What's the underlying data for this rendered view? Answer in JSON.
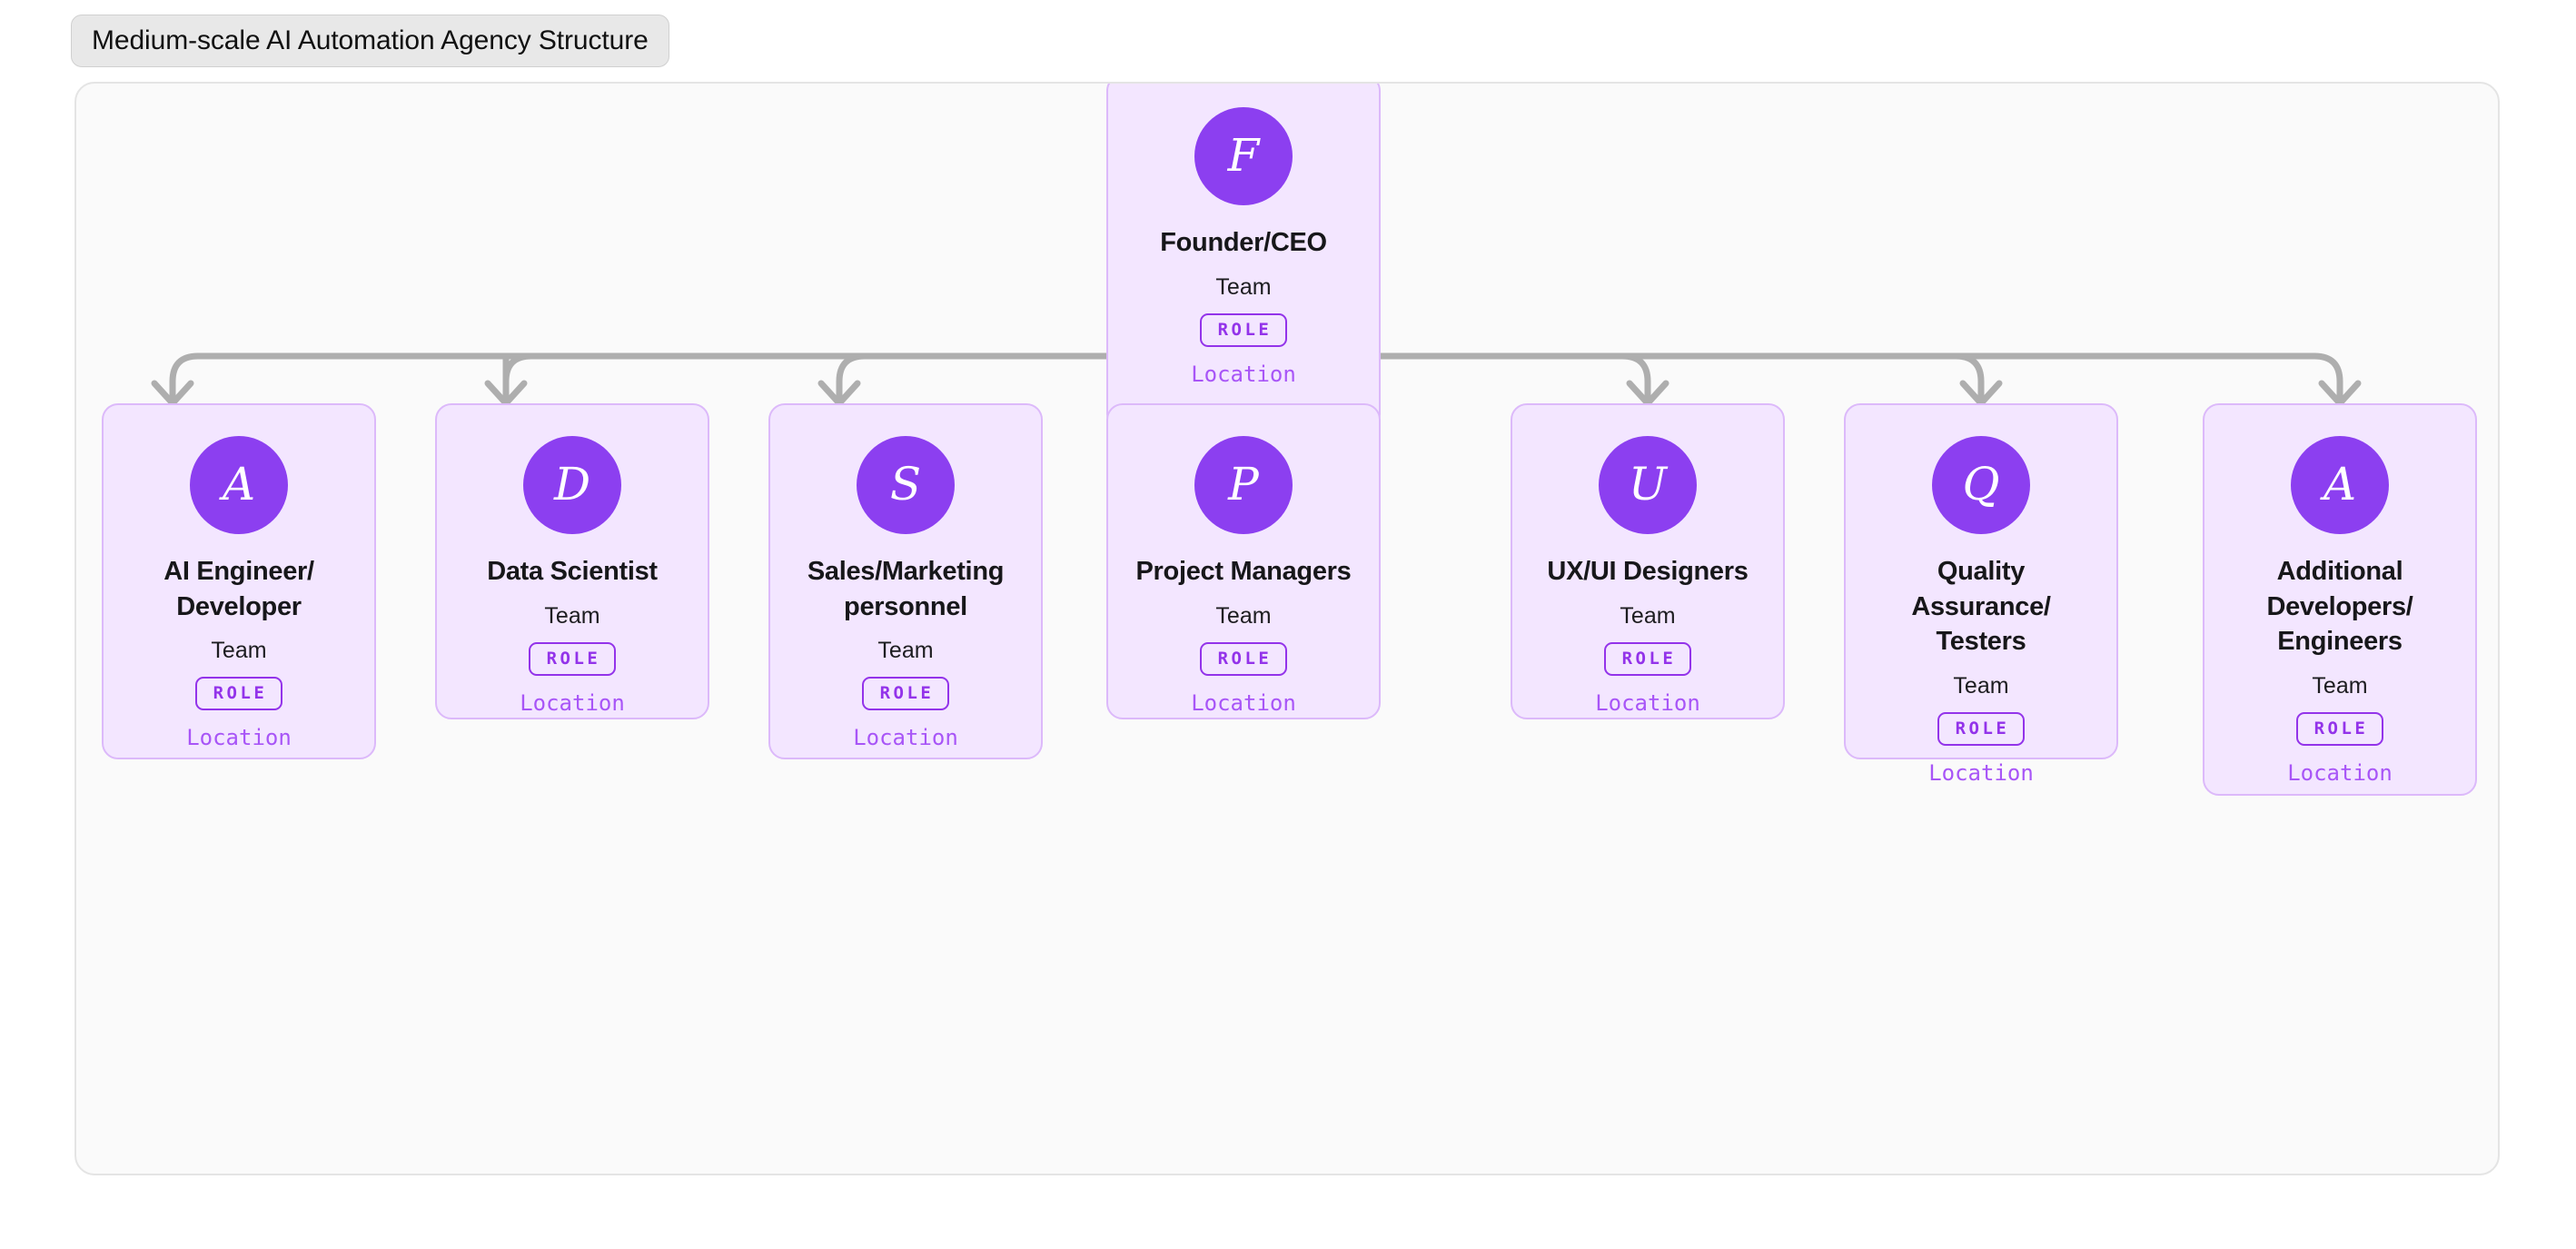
{
  "header": {
    "title": "Medium-scale AI Automation Agency Structure"
  },
  "colors": {
    "avatar_purple": "#8c3ff0",
    "card_background": "#f3e6ff",
    "card_border": "#dcb9fa",
    "role_badge_border": "#9333ea",
    "role_badge_text": "#9333ea",
    "location_text": "#a855f7",
    "connector": "#aeaeae",
    "canvas_background": "#fafafa",
    "canvas_border": "#e4e4e4",
    "title_chip_background": "#e8e8e8",
    "title_text": "#111111",
    "node_title_text": "#17171a"
  },
  "chart_data": {
    "type": "diagram",
    "diagram_type": "organizational-chart",
    "title": "Medium-scale AI Automation Agency Structure",
    "layout": "top-down single-level hierarchy, root centered above seven children",
    "levels": 2,
    "node_count": 8,
    "edge_count": 7,
    "root": {
      "id": "founder-ceo",
      "initial": "F",
      "title": "Founder/CEO",
      "team": "Team",
      "role": "ROLE",
      "location": "Location"
    },
    "children": [
      {
        "id": "ai-engineer-developer",
        "initial": "A",
        "title": "AI Engineer/ Developer",
        "team": "Team",
        "role": "ROLE",
        "location": "Location"
      },
      {
        "id": "data-scientist",
        "initial": "D",
        "title": "Data Scientist",
        "team": "Team",
        "role": "ROLE",
        "location": "Location"
      },
      {
        "id": "sales-marketing-personnel",
        "initial": "S",
        "title": "Sales/Marketing personnel",
        "team": "Team",
        "role": "ROLE",
        "location": "Location"
      },
      {
        "id": "project-managers",
        "initial": "P",
        "title": "Project Managers",
        "team": "Team",
        "role": "ROLE",
        "location": "Location"
      },
      {
        "id": "ux-ui-designers",
        "initial": "U",
        "title": "UX/UI Designers",
        "team": "Team",
        "role": "ROLE",
        "location": "Location"
      },
      {
        "id": "quality-assurance-testers",
        "initial": "Q",
        "title": "Quality Assurance/ Testers",
        "team": "Team",
        "role": "ROLE",
        "location": "Location"
      },
      {
        "id": "additional-developers-engineers",
        "initial": "A",
        "title": "Additional Developers/ Engineers",
        "team": "Team",
        "role": "ROLE",
        "location": "Location"
      }
    ],
    "edges": [
      {
        "from": "founder-ceo",
        "to": "ai-engineer-developer"
      },
      {
        "from": "founder-ceo",
        "to": "data-scientist"
      },
      {
        "from": "founder-ceo",
        "to": "sales-marketing-personnel"
      },
      {
        "from": "founder-ceo",
        "to": "project-managers"
      },
      {
        "from": "founder-ceo",
        "to": "ux-ui-designers"
      },
      {
        "from": "founder-ceo",
        "to": "quality-assurance-testers"
      },
      {
        "from": "founder-ceo",
        "to": "additional-developers-engineers"
      }
    ]
  }
}
